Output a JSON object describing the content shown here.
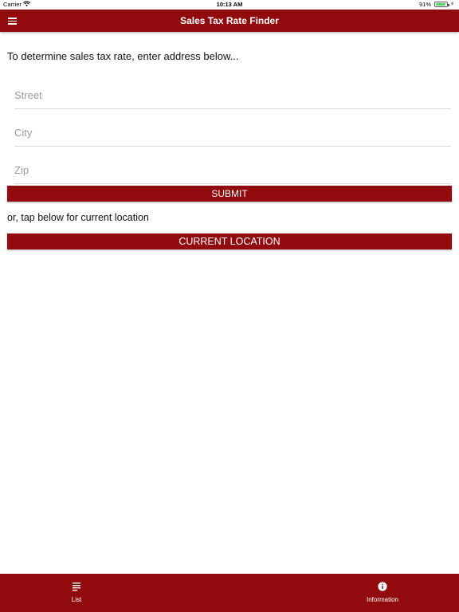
{
  "status_bar": {
    "carrier": "Carrier",
    "time": "10:13 AM",
    "battery": "91%",
    "battery_level": 0.91
  },
  "header": {
    "title": "Sales Tax Rate Finder",
    "menu_icon": "hamburger-menu-icon"
  },
  "form": {
    "intro": "To determine sales tax rate, enter address below...",
    "street_placeholder": "Street",
    "city_placeholder": "City",
    "zip_placeholder": "Zip",
    "submit_label": "SUBMIT",
    "or_text": "or, tap below for current location",
    "current_location_label": "CURRENT LOCATION"
  },
  "tabs": [
    {
      "label": "List",
      "icon": "list-icon"
    },
    {
      "label": "Information",
      "icon": "info-icon"
    }
  ],
  "colors": {
    "brand": "#910a0e",
    "battery": "#4cd964"
  }
}
